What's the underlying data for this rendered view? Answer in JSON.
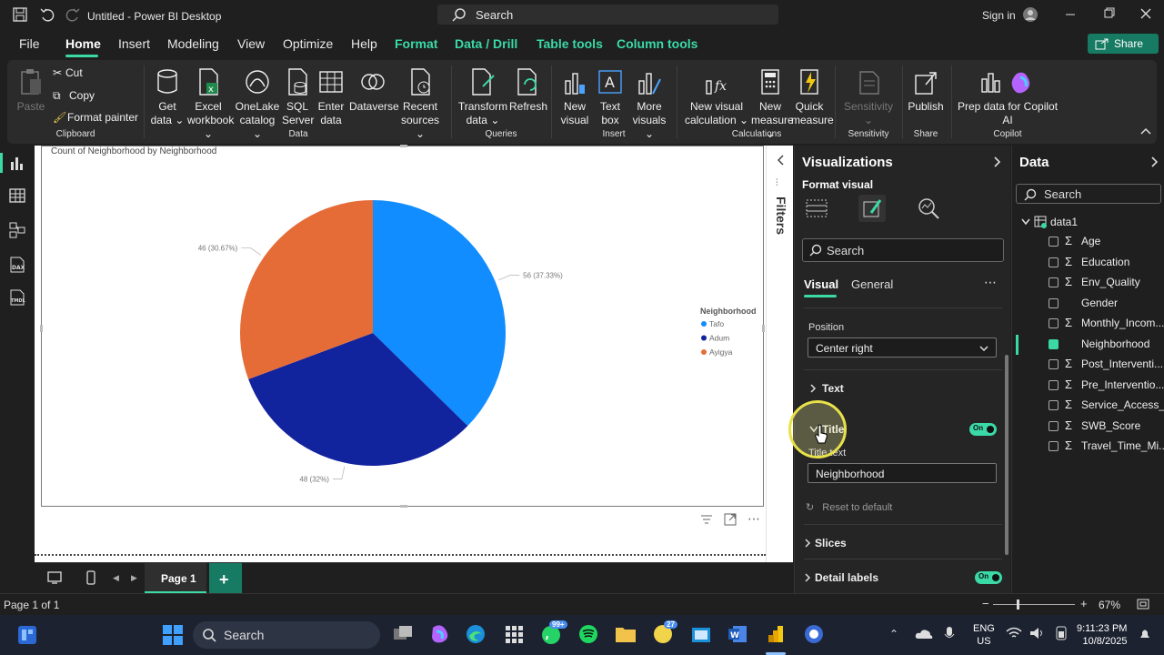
{
  "titlebar": {
    "title": "Untitled - Power BI Desktop",
    "search_placeholder": "Search",
    "signin": "Sign in"
  },
  "menu": {
    "file": "File",
    "home": "Home",
    "insert": "Insert",
    "modeling": "Modeling",
    "view": "View",
    "optimize": "Optimize",
    "help": "Help",
    "format": "Format",
    "data_drill": "Data / Drill",
    "table_tools": "Table tools",
    "column_tools": "Column tools",
    "share": "Share"
  },
  "ribbon": {
    "paste": "Paste",
    "cut": "Cut",
    "copy": "Copy",
    "format_painter": "Format painter",
    "clipboard": "Clipboard",
    "get_data": [
      "Get",
      "data ⌄"
    ],
    "excel": [
      "Excel",
      "workbook ⌄"
    ],
    "onelake": [
      "OneLake",
      "catalog ⌄"
    ],
    "sql": [
      "SQL",
      "Server"
    ],
    "enter": [
      "Enter",
      "data"
    ],
    "dataverse": "Dataverse",
    "recent": [
      "Recent",
      "sources ⌄"
    ],
    "data_group": "Data",
    "transform": [
      "Transform",
      "data ⌄"
    ],
    "refresh": "Refresh",
    "queries": "Queries",
    "new_visual": [
      "New",
      "visual"
    ],
    "text_box": [
      "Text",
      "box"
    ],
    "more_visuals": [
      "More",
      "visuals ⌄"
    ],
    "insert_group": "Insert",
    "new_visual_calc": [
      "New visual",
      "calculation ⌄"
    ],
    "new_measure": [
      "New",
      "measure ⌄"
    ],
    "quick_measure": [
      "Quick",
      "measure"
    ],
    "calculations": "Calculations",
    "sensitivity": [
      "Sensitivity",
      "⌄"
    ],
    "sensitivity_group": "Sensitivity",
    "publish": "Publish",
    "share_group": "Share",
    "prep_copilot": [
      "Prep data for Copilot",
      "AI"
    ],
    "copilot": "Copilot"
  },
  "canvas": {
    "chart_title": "Count of Neighborhood by Neighborhood"
  },
  "chart_data": {
    "type": "pie",
    "title": "Count of Neighborhood by Neighborhood",
    "legend_title": "Neighborhood",
    "legend_position": "right",
    "slices": [
      {
        "name": "Tafo",
        "value": 56,
        "label": "56 (37.33%)",
        "color": "#118DFF"
      },
      {
        "name": "Adum",
        "value": 48,
        "label": "48 (32%)",
        "color": "#12239E"
      },
      {
        "name": "Ayigya",
        "value": 46,
        "label": "46 (30.67%)",
        "color": "#E66C37"
      }
    ]
  },
  "filters": {
    "label": "Filters"
  },
  "pages": {
    "tab": "Page 1",
    "count": "Page 1 of 1",
    "zoom": "67%"
  },
  "viz": {
    "title": "Visualizations",
    "format_visual": "Format visual",
    "search": "Search",
    "tab_visual": "Visual",
    "tab_general": "General",
    "position_label": "Position",
    "position_value": "Center right",
    "text_section": "Text",
    "title_section": "Title",
    "title_toggle": "On",
    "title_text_label": "Title text",
    "title_text_value": "Neighborhood",
    "reset": "Reset to default",
    "slices": "Slices",
    "detail_labels": "Detail labels",
    "detail_toggle": "On"
  },
  "data": {
    "title": "Data",
    "search": "Search",
    "table": "data1",
    "fields": [
      {
        "name": "Age",
        "sigma": "Σ",
        "checked": false
      },
      {
        "name": "Education",
        "sigma": "Σ",
        "checked": false
      },
      {
        "name": "Env_Quality",
        "sigma": "Σ",
        "checked": false
      },
      {
        "name": "Gender",
        "sigma": "",
        "checked": false
      },
      {
        "name": "Monthly_Incom...",
        "sigma": "Σ",
        "checked": false
      },
      {
        "name": "Neighborhood",
        "sigma": "",
        "checked": true
      },
      {
        "name": "Post_Interventi...",
        "sigma": "Σ",
        "checked": false
      },
      {
        "name": "Pre_Interventio...",
        "sigma": "Σ",
        "checked": false
      },
      {
        "name": "Service_Access_...",
        "sigma": "Σ",
        "checked": false
      },
      {
        "name": "SWB_Score",
        "sigma": "Σ",
        "checked": false
      },
      {
        "name": "Travel_Time_Mi...",
        "sigma": "Σ",
        "checked": false
      }
    ]
  },
  "taskbar": {
    "search": "Search",
    "whatsapp_badge": "99+",
    "notif_badge": "27",
    "lang": [
      "ENG",
      "US"
    ],
    "time": "9:11:23 PM",
    "date": "10/8/2025"
  }
}
